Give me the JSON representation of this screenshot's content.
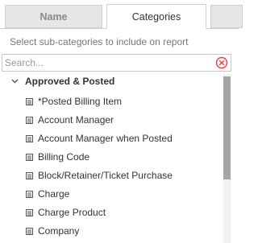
{
  "tabs": [
    {
      "label": "Name"
    },
    {
      "label": "Categories",
      "active": true
    }
  ],
  "instruction": "Select sub-categories to include on report",
  "search": {
    "placeholder": "Search...",
    "value": "",
    "clear_icon": "clear-circle-x-icon"
  },
  "tree": {
    "group": {
      "label": "Approved & Posted",
      "expanded": true,
      "icon": "chevron-down-icon"
    },
    "items": [
      {
        "label": "*Posted Billing Item",
        "icon": "list-icon"
      },
      {
        "label": "Account Manager",
        "icon": "list-icon"
      },
      {
        "label": "Account Manager when Posted",
        "icon": "list-icon"
      },
      {
        "label": "Billing Code",
        "icon": "list-icon"
      },
      {
        "label": "Block/Retainer/Ticket Purchase",
        "icon": "list-icon"
      },
      {
        "label": "Charge",
        "icon": "list-icon"
      },
      {
        "label": "Charge Product",
        "icon": "list-icon"
      },
      {
        "label": "Company",
        "icon": "list-icon"
      }
    ]
  },
  "colors": {
    "clear_icon": "#e0404a",
    "scroll_thumb": "#a6a6a6"
  }
}
